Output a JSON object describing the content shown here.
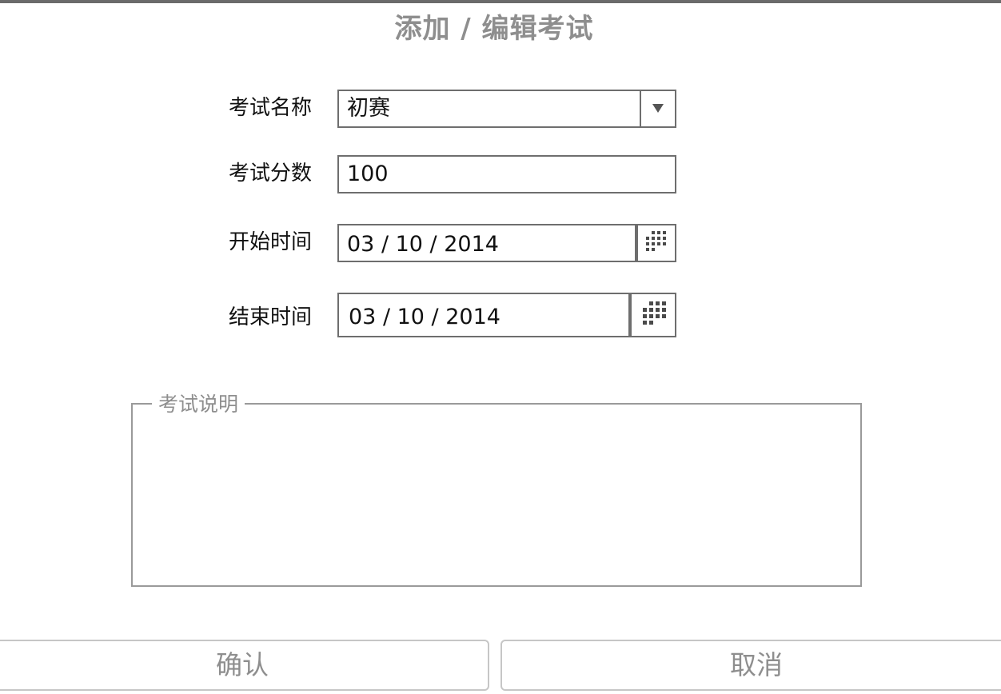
{
  "dialog": {
    "title": "添加 / 编辑考试"
  },
  "form": {
    "exam_name": {
      "label": "考试名称",
      "value": "初赛"
    },
    "exam_score": {
      "label": "考试分数",
      "value": "100"
    },
    "start_time": {
      "label": "开始时间",
      "value": "03 / 10 / 2014"
    },
    "end_time": {
      "label": "结束时间",
      "value": "03 / 10 / 2014"
    },
    "description": {
      "legend": "考试说明",
      "value": ""
    }
  },
  "buttons": {
    "confirm": "确认",
    "cancel": "取消"
  },
  "icons": {
    "dropdown": "chevron-down-icon",
    "calendar": "calendar-icon"
  },
  "colors": {
    "title_gray": "#8e8e8e",
    "border": "#6e6e6e",
    "button_border": "#c6c6c6"
  }
}
